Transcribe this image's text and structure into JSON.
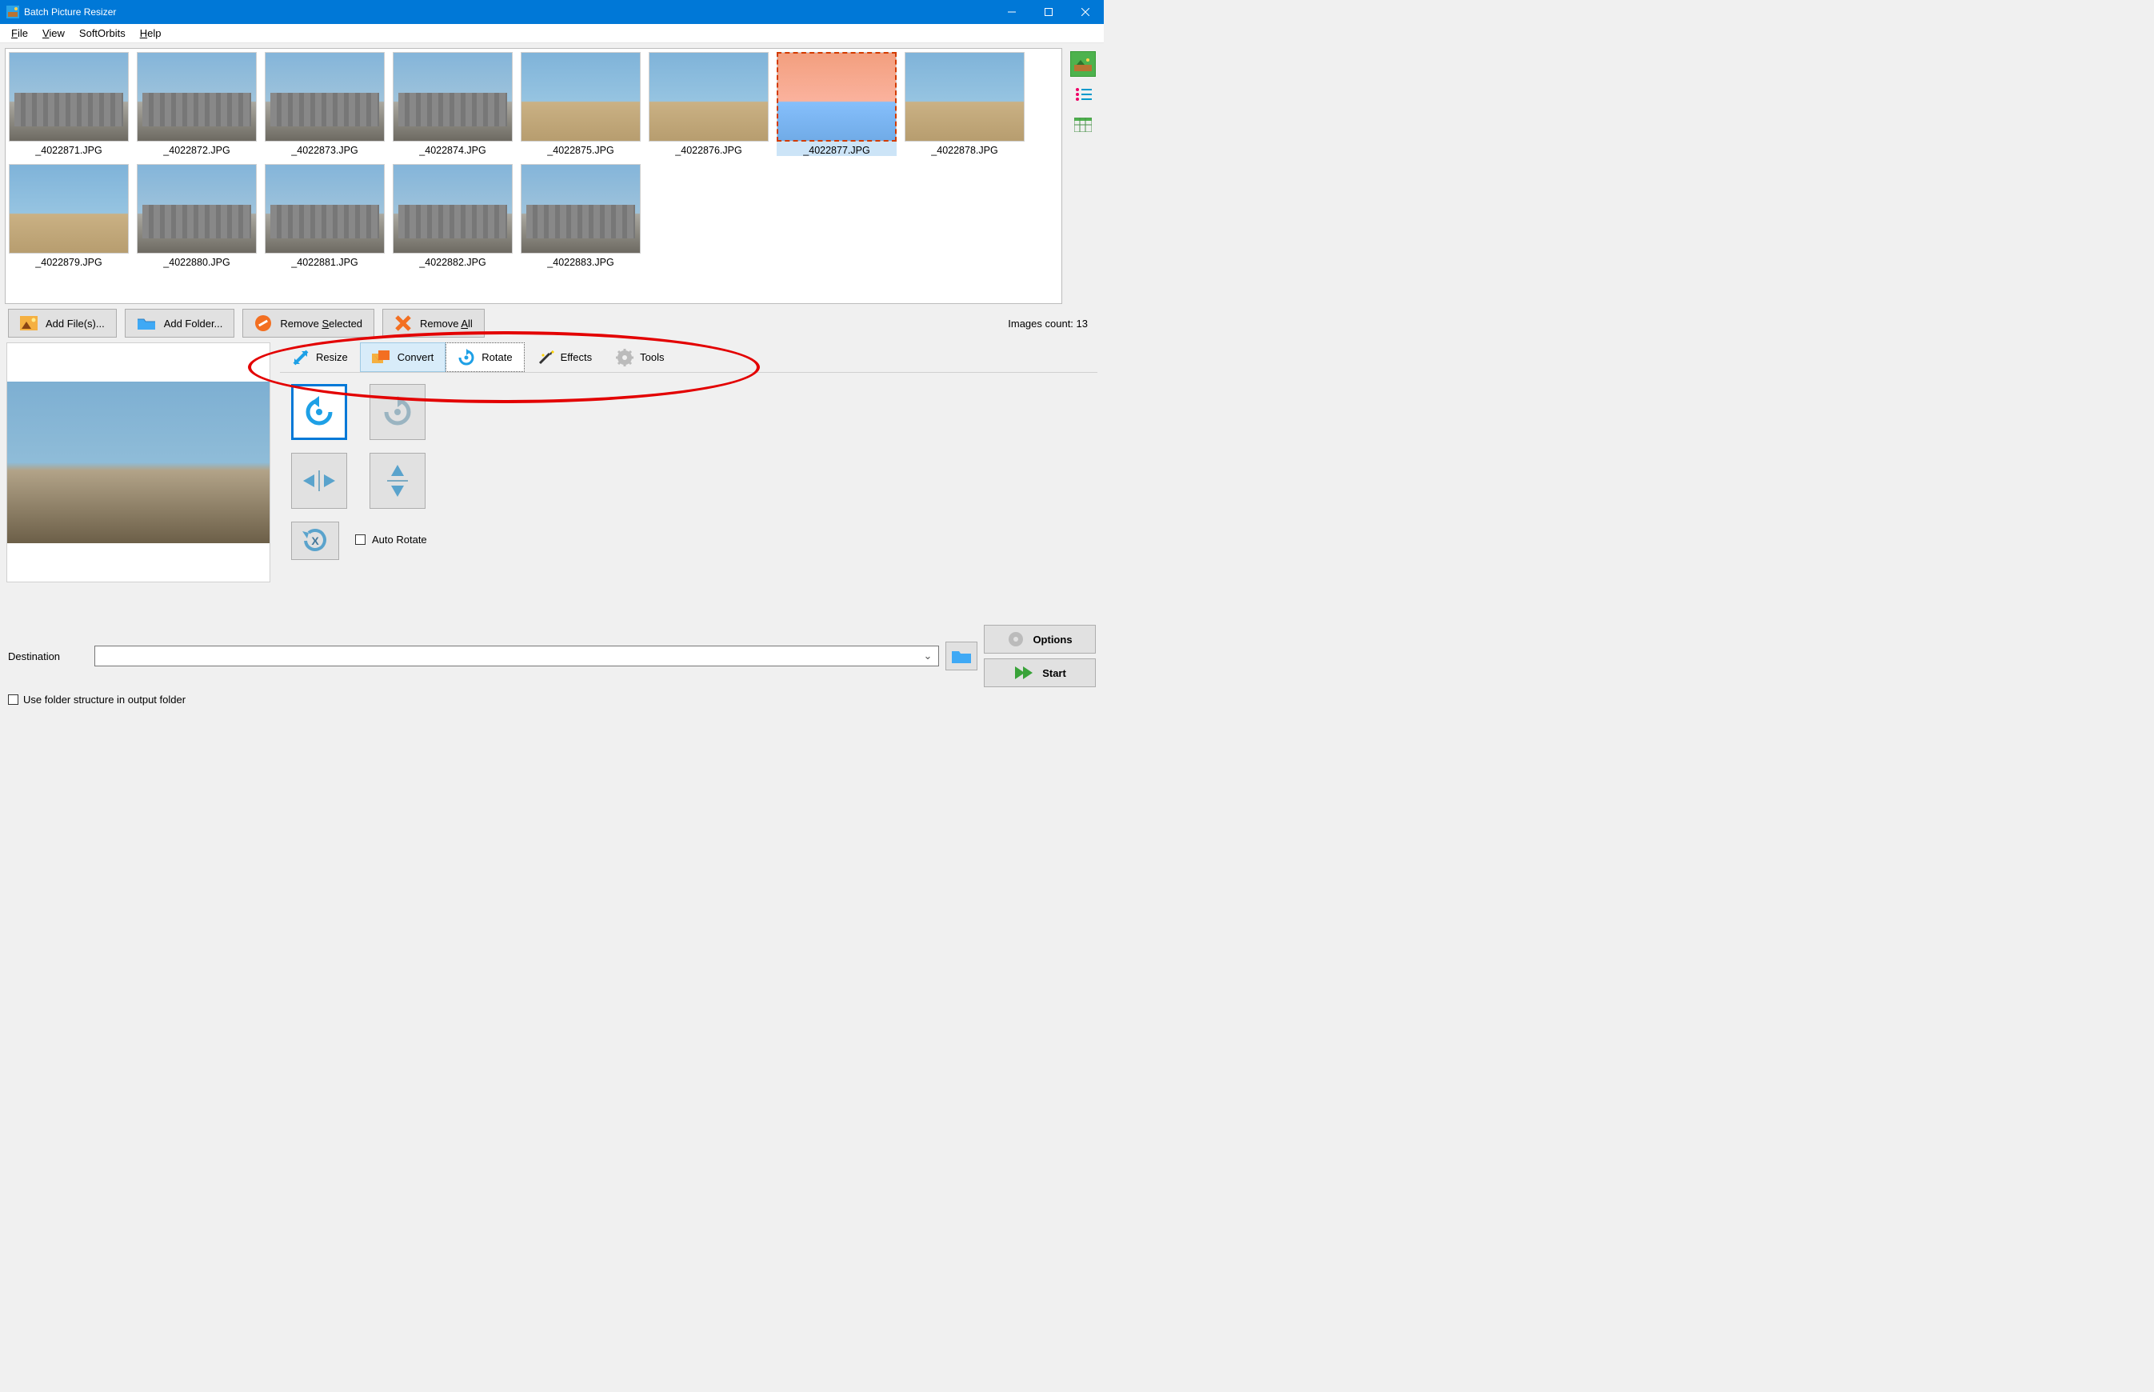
{
  "titlebar": {
    "title": "Batch Picture Resizer"
  },
  "menu": {
    "file": "File",
    "view": "View",
    "softorbits": "SoftOrbits",
    "help": "Help"
  },
  "thumbnails": [
    {
      "name": "_4022871.JPG",
      "type": "urban",
      "selected": false
    },
    {
      "name": "_4022872.JPG",
      "type": "urban",
      "selected": false
    },
    {
      "name": "_4022873.JPG",
      "type": "urban",
      "selected": false
    },
    {
      "name": "_4022874.JPG",
      "type": "urban",
      "selected": false
    },
    {
      "name": "_4022875.JPG",
      "type": "plain",
      "selected": false
    },
    {
      "name": "_4022876.JPG",
      "type": "plain",
      "selected": false
    },
    {
      "name": "_4022877.JPG",
      "type": "plain",
      "selected": true
    },
    {
      "name": "_4022878.JPG",
      "type": "plain",
      "selected": false
    },
    {
      "name": "_4022879.JPG",
      "type": "plain",
      "selected": false
    },
    {
      "name": "_4022880.JPG",
      "type": "urban",
      "selected": false
    },
    {
      "name": "_4022881.JPG",
      "type": "urban",
      "selected": false
    },
    {
      "name": "_4022882.JPG",
      "type": "urban",
      "selected": false
    },
    {
      "name": "_4022883.JPG",
      "type": "urban",
      "selected": false
    }
  ],
  "filebuttons": {
    "add_files": "Add File(s)...",
    "add_folder": "Add Folder...",
    "remove_selected": "Remove Selected",
    "remove_all": "Remove All"
  },
  "images_count_label": "Images count: 13",
  "tabs": {
    "resize": "Resize",
    "convert": "Convert",
    "rotate": "Rotate",
    "effects": "Effects",
    "tools": "Tools",
    "active": "rotate",
    "hover": "convert"
  },
  "rotate_panel": {
    "auto_rotate_label": "Auto Rotate",
    "auto_rotate_checked": false
  },
  "destination": {
    "label": "Destination",
    "value": "",
    "folder_structure_label": "Use folder structure in output folder",
    "folder_structure_checked": false
  },
  "buttons": {
    "options": "Options",
    "start": "Start"
  }
}
